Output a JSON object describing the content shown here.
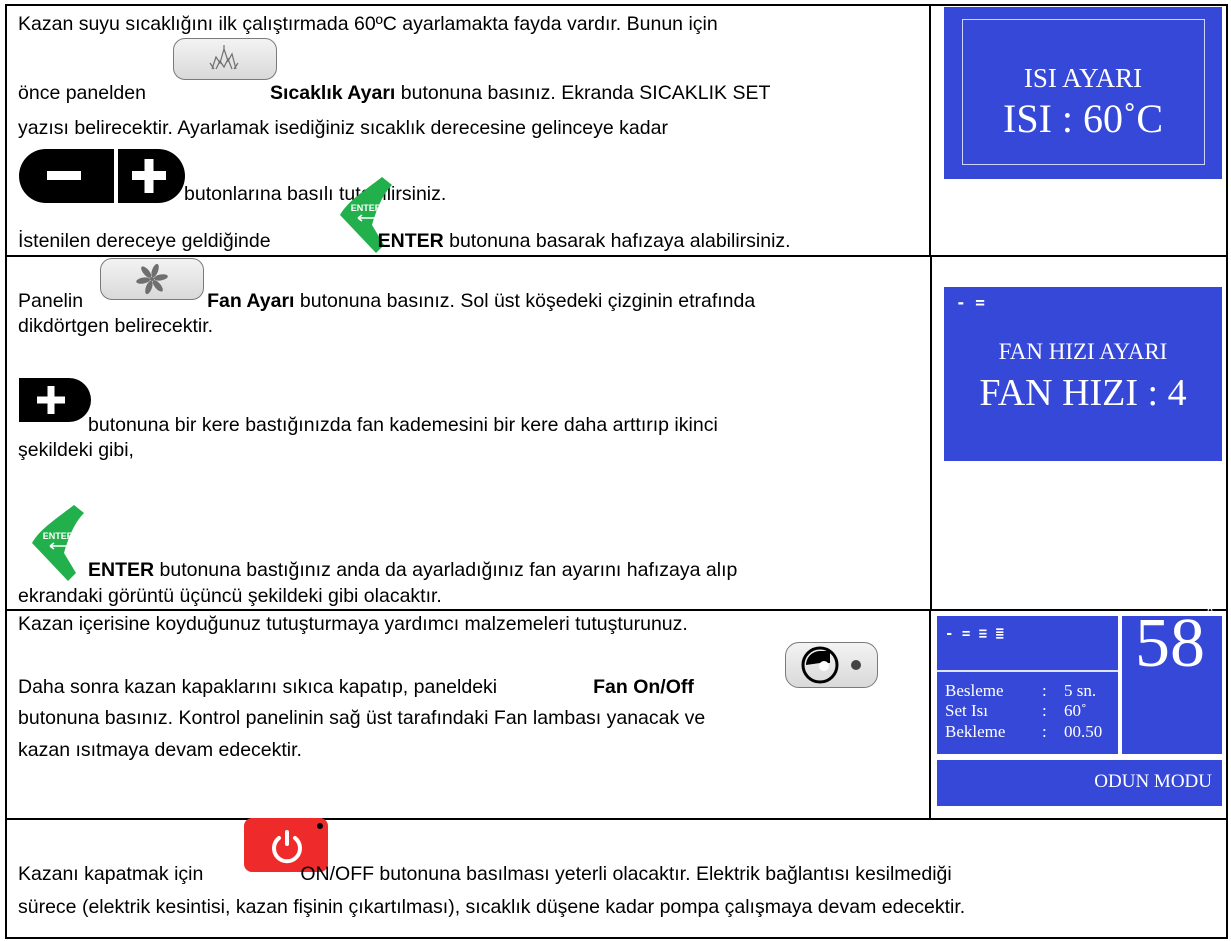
{
  "colors": {
    "display_blue": "#3648d8",
    "enter_green": "#22b04c",
    "power_red": "#ef2a2a"
  },
  "row1": {
    "l1": "Kazan suyu sıcaklığını ilk çalıştırmada 60ºC ayarlamakta fayda vardır. Bunun için",
    "l2_pre": "önce panelden",
    "l2_bold": "Sıcaklık Ayarı",
    "l2_post": " butonuna basınız. Ekranda SICAKLIK SET",
    "l3": "yazısı belirecektir. Ayarlamak isediğiniz sıcaklık derecesine gelinceye kadar",
    "l4": "butonlarına basılı tutabilirsiniz.",
    "l5_pre": "İstenilen dereceye geldiğinde",
    "l5_bold": "ENTER",
    "l5_post": " butonuna basarak hafızaya alabilirsiniz.",
    "display": {
      "title": "ISI AYARI",
      "value": "ISI :  60˚C"
    },
    "icons": [
      "flame-icon",
      "minus-icon",
      "plus-icon",
      "enter-icon"
    ]
  },
  "row2": {
    "l1_pre": "Panelin",
    "l1_bold": "Fan Ayarı",
    "l1_post": " butonuna basınız. Sol üst köşedeki çizginin etrafında",
    "l2": "dikdörtgen belirecektir.",
    "l3": " butonuna bir kere bastığınızda fan kademesini bir kere daha arttırıp ikinci",
    "l4": "şekildeki gibi,",
    "l5_bold": "ENTER",
    "l5_post": " butonuna bastığınız anda da ayarladığınız fan ayarını hafızaya alıp",
    "l6": "ekrandaki görüntü üçüncü şekildeki gibi olacaktır.",
    "display": {
      "corner": "- =",
      "title": "FAN HIZI AYARI",
      "value": "FAN HIZI : 4"
    },
    "icons": [
      "fan-icon",
      "plus-icon",
      "enter-icon"
    ]
  },
  "row3": {
    "l1": "Kazan içerisine koyduğunuz tutuşturmaya yardımcı malzemeleri tutuşturunuz.",
    "l2_pre": "Daha sonra kazan kapaklarını sıkıca kapatıp, paneldeki",
    "l2_bold": "Fan On/Off",
    "l3": "butonuna basınız. Kontrol panelinin sağ üst tarafındaki Fan lambası yanacak ve",
    "l4": "kazan ısıtmaya devam edecektir.",
    "display": {
      "bars": "- = ≡ ≣",
      "temperature": "58",
      "degree": "˚",
      "rows": [
        {
          "label": "Besleme",
          "sep": ":",
          "value": "5 sn."
        },
        {
          "label": "Set Isı",
          "sep": ":",
          "value": "60˚"
        },
        {
          "label": "Bekleme",
          "sep": ":",
          "value": "00.50"
        }
      ],
      "mode": "ODUN MODU"
    },
    "icons": [
      "fan-on-off-icon"
    ]
  },
  "row4": {
    "l1_pre": "Kazanı kapatmak için",
    "l1_post": "ON/OFF butonuna basılması yeterli olacaktır. Elektrik bağlantısı kesilmediği",
    "l2": "sürece (elektrik kesintisi, kazan fişinin çıkartılması), sıcaklık düşene kadar pompa çalışmaya devam edecektir.",
    "icons": [
      "power-icon"
    ]
  }
}
